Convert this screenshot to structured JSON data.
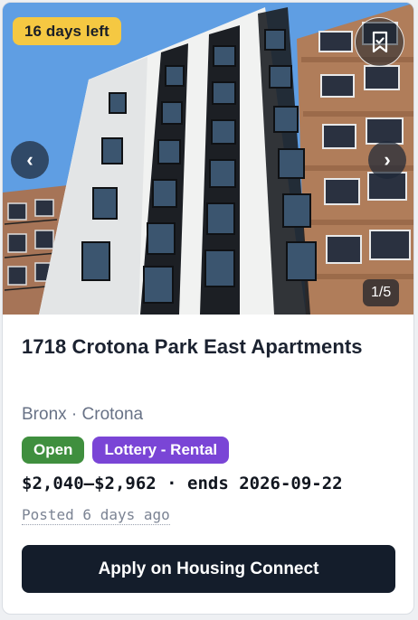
{
  "listing": {
    "days_left": "16 days left",
    "photo_counter": "1/5",
    "title": "1718 Crotona Park East Apartments",
    "location": "Bronx · Crotona",
    "tags": [
      "Open",
      "Lottery - Rental"
    ],
    "price_line": "$2,040–$2,962 · ends 2026-09-22",
    "posted": "Posted 6 days ago",
    "apply_label": "Apply on Housing Connect"
  },
  "icons": {
    "save": "bookmark-icon",
    "prev": "chevron-left-icon",
    "next": "chevron-right-icon"
  },
  "colors": {
    "badge_yellow": "#f5c842",
    "open_green": "#3f8f3e",
    "lottery_purple": "#7a45d6",
    "apply_dark": "#141d2b"
  }
}
